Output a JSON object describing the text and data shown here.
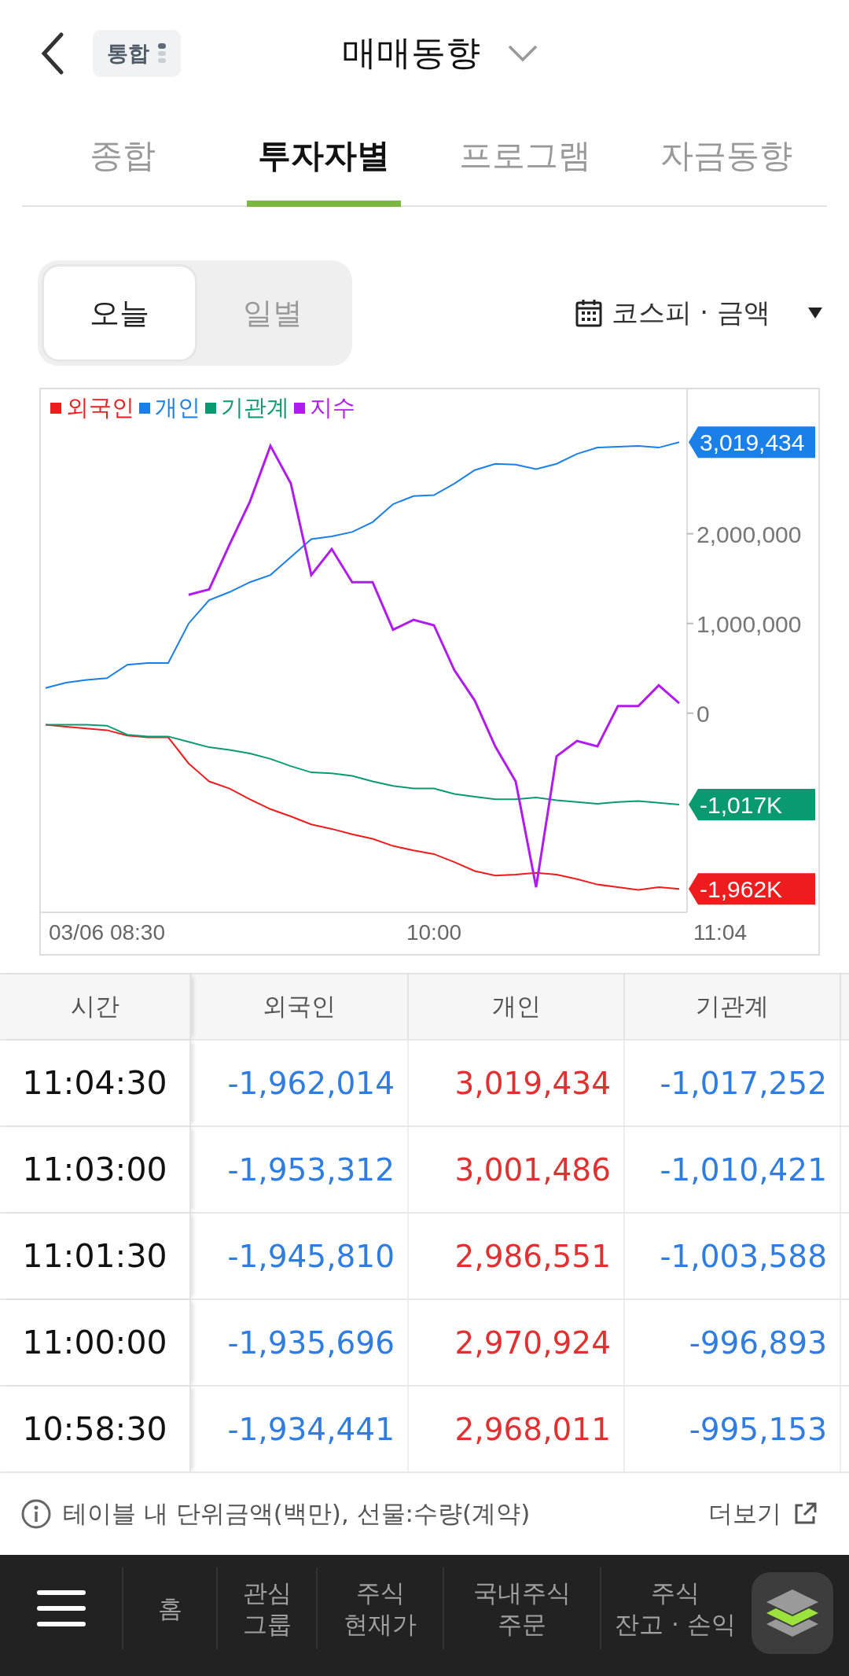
{
  "header": {
    "badge": "통합",
    "title": "매매동향"
  },
  "tabs": [
    {
      "label": "종합",
      "selected": false
    },
    {
      "label": "투자자별",
      "selected": true
    },
    {
      "label": "프로그램",
      "selected": false
    },
    {
      "label": "자금동향",
      "selected": false
    }
  ],
  "period_toggle": [
    {
      "label": "오늘",
      "selected": true
    },
    {
      "label": "일별",
      "selected": false
    }
  ],
  "market_selector": {
    "label": "코스피 · 금액"
  },
  "chart": {
    "chart_data": {
      "type": "line",
      "legend": "top-left",
      "categories": [
        null,
        null,
        null,
        "03/06 08:30",
        null,
        null,
        null,
        null,
        null,
        null,
        null,
        null,
        null,
        null,
        null,
        null,
        null,
        null,
        null,
        "10:00",
        null,
        null,
        null,
        null,
        null,
        null,
        null,
        null,
        null,
        null,
        null,
        null,
        null,
        "11:04"
      ],
      "ylim": [
        -2220000,
        3610000
      ],
      "yticks": [
        {
          "value": 0,
          "label": "0"
        },
        {
          "value": 1000000,
          "label": "1,000,000"
        },
        {
          "value": 2000000,
          "label": "2,000,000"
        }
      ],
      "series": [
        {
          "name": "외국인",
          "color": "#ee1c1c",
          "values": [
            -130000,
            -150000,
            -170000,
            -190000,
            -250000,
            -270000,
            -270000,
            -560000,
            -760000,
            -840000,
            -960000,
            -1070000,
            -1150000,
            -1240000,
            -1290000,
            -1350000,
            -1400000,
            -1480000,
            -1530000,
            -1570000,
            -1660000,
            -1760000,
            -1810000,
            -1800000,
            -1780000,
            -1800000,
            -1850000,
            -1910000,
            -1940000,
            -1970000,
            -1940000,
            -1960000,
            null,
            null
          ]
        },
        {
          "name": "개인",
          "color": "#1a7fe8",
          "values": [
            280000,
            340000,
            370000,
            390000,
            540000,
            560000,
            560000,
            1000000,
            1260000,
            1350000,
            1460000,
            1540000,
            1740000,
            1940000,
            1970000,
            2020000,
            2130000,
            2330000,
            2420000,
            2430000,
            2560000,
            2710000,
            2780000,
            2770000,
            2720000,
            2780000,
            2890000,
            2960000,
            2970000,
            2980000,
            2960000,
            3020000,
            null,
            null
          ]
        },
        {
          "name": "기관계",
          "color": "#0a9a72",
          "values": [
            -130000,
            -130000,
            -130000,
            -140000,
            -240000,
            -260000,
            -260000,
            -320000,
            -380000,
            -410000,
            -450000,
            -510000,
            -590000,
            -660000,
            -670000,
            -700000,
            -760000,
            -810000,
            -840000,
            -840000,
            -900000,
            -930000,
            -960000,
            -960000,
            -940000,
            -970000,
            -990000,
            -1010000,
            -990000,
            -980000,
            -1000000,
            -1020000,
            null,
            null
          ]
        },
        {
          "name": "지수",
          "color": "#b01bf0",
          "values": [
            null,
            null,
            null,
            null,
            null,
            null,
            null,
            1320000,
            1380000,
            1880000,
            2360000,
            2980000,
            2560000,
            1540000,
            1830000,
            1460000,
            1460000,
            930000,
            1040000,
            980000,
            480000,
            140000,
            -370000,
            -760000,
            -1940000,
            -480000,
            -310000,
            -370000,
            80000,
            80000,
            310000,
            110000,
            null,
            null
          ]
        }
      ]
    },
    "value_flags": [
      {
        "color": "#1a7fe8",
        "text": "3,019,434"
      },
      {
        "color": "#0a9a72",
        "text": "-1,017K"
      },
      {
        "color": "#ee1c1c",
        "text": "-1,962K"
      }
    ]
  },
  "table": {
    "columns": [
      "시간",
      "외국인",
      "개인",
      "기관계"
    ],
    "rows": [
      {
        "cells": [
          {
            "value": "11:04:30"
          },
          {
            "value": "-1,962,014",
            "color": "#2f7de1"
          },
          {
            "value": "3,019,434",
            "color": "#e03131"
          },
          {
            "value": "-1,017,252",
            "color": "#2f7de1"
          }
        ]
      },
      {
        "cells": [
          {
            "value": "11:03:00"
          },
          {
            "value": "-1,953,312",
            "color": "#2f7de1"
          },
          {
            "value": "3,001,486",
            "color": "#e03131"
          },
          {
            "value": "-1,010,421",
            "color": "#2f7de1"
          }
        ]
      },
      {
        "cells": [
          {
            "value": "11:01:30"
          },
          {
            "value": "-1,945,810",
            "color": "#2f7de1"
          },
          {
            "value": "2,986,551",
            "color": "#e03131"
          },
          {
            "value": "-1,003,588",
            "color": "#2f7de1"
          }
        ]
      },
      {
        "cells": [
          {
            "value": "11:00:00"
          },
          {
            "value": "-1,935,696",
            "color": "#2f7de1"
          },
          {
            "value": "2,970,924",
            "color": "#e03131"
          },
          {
            "value": "-996,893",
            "color": "#2f7de1"
          }
        ]
      },
      {
        "cells": [
          {
            "value": "10:58:30"
          },
          {
            "value": "-1,934,441",
            "color": "#2f7de1"
          },
          {
            "value": "2,968,011",
            "color": "#e03131"
          },
          {
            "value": "-995,153",
            "color": "#2f7de1"
          }
        ]
      }
    ]
  },
  "footnote": {
    "text": "테이블 내 단위금액(백만), 선물:수량(계약)",
    "more": "더보기"
  },
  "bottom_nav": [
    {
      "lines": [
        "홈"
      ]
    },
    {
      "lines": [
        "관심",
        "그룹"
      ]
    },
    {
      "lines": [
        "주식",
        "현재가"
      ]
    },
    {
      "lines": [
        "국내주식",
        "주문"
      ]
    },
    {
      "lines": [
        "주식",
        "잔고 · 손익"
      ]
    }
  ]
}
